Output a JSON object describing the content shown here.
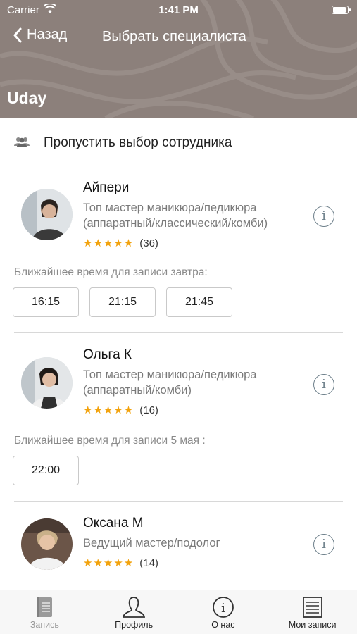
{
  "status_bar": {
    "carrier": "Carrier",
    "time": "1:41 PM"
  },
  "nav": {
    "back_label": "Назад",
    "title": "Выбрать специалиста"
  },
  "salon": {
    "name": "Uday"
  },
  "skip": {
    "label": "Пропустить выбор сотрудника"
  },
  "colors": {
    "header": "#8c807b",
    "star": "#f2a20c",
    "info": "#6d7f8a"
  },
  "employees": [
    {
      "name": "Айпери",
      "desc_line1": "Топ мастер маникюра/педикюра",
      "desc_line2": "(аппаратный/классический/комби)",
      "stars": "★★★★★",
      "reviews": "(36)",
      "nearest": "Ближайшее время для записи завтра:",
      "slots": [
        "16:15",
        "21:15",
        "21:45"
      ]
    },
    {
      "name": "Ольга К",
      "desc_line1": "Топ мастер маникюра/педикюра",
      "desc_line2": "(аппаратный/комби)",
      "stars": "★★★★★",
      "reviews": "(16)",
      "nearest": "Ближайшее время для записи 5 мая :",
      "slots": [
        "22:00"
      ]
    },
    {
      "name": "Оксана М",
      "desc_line1": "Ведущий мастер/подолог",
      "stars": "★★★★★",
      "reviews": "(14)"
    }
  ],
  "tabs": [
    {
      "label": "Запись",
      "icon": "book-icon",
      "active": true
    },
    {
      "label": "Профиль",
      "icon": "person-icon",
      "active": false
    },
    {
      "label": "О нас",
      "icon": "info-icon",
      "active": false
    },
    {
      "label": "Мои записи",
      "icon": "list-icon",
      "active": false
    }
  ]
}
